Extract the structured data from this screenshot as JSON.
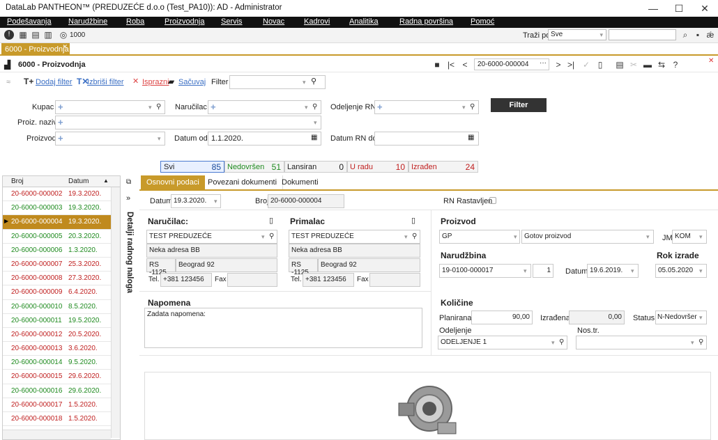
{
  "window": {
    "title": "DataLab PANTHEON™  (PREDUZEĆE d.o.o (Test_PA10)): AD - Administrator",
    "min": "—",
    "max": "☐",
    "close": "✕"
  },
  "menu": [
    "Podešavanja",
    "Narudžbine",
    "Roba",
    "Proizvodnja",
    "Servis",
    "Novac",
    "Kadrovi",
    "Analitika",
    "Radna površina",
    "Pomoć"
  ],
  "toolbar": {
    "counter": "1000",
    "search_label": "Traži po",
    "search_option": "Sve"
  },
  "doc_tab": "6000 - Proizvodnja",
  "module": {
    "title": "6000 - Proizvodnja",
    "doc_number": "20-6000-000004"
  },
  "filterbar": {
    "add": "Dodaj filter",
    "remove": "Izbriši filter",
    "clear": "Isprazni",
    "save": "Sačuvaj",
    "filter": "Filter"
  },
  "filters": {
    "kupac": "Kupac",
    "narucilac": "Naručilac",
    "odeljenje": "Odeljenje RN",
    "proiz_naziv": "Proiz. naziv",
    "proizvod": "Proizvod",
    "datum_od": "Datum od",
    "datum_od_val": "1.1.2020.",
    "datum_do": "Datum RN do",
    "button": "Filter"
  },
  "status": [
    {
      "label": "Svi",
      "count": "85",
      "color": "#1a4a9a"
    },
    {
      "label": "Nedovršen",
      "count": "51",
      "color": "#1e8a1e"
    },
    {
      "label": "Lansiran",
      "count": "0",
      "color": "#222222"
    },
    {
      "label": "U radu",
      "count": "10",
      "color": "#c02020"
    },
    {
      "label": "Izrađen",
      "count": "24",
      "color": "#c02020"
    }
  ],
  "grid": {
    "col_broj": "Broj",
    "col_datum": "Datum",
    "rows": [
      [
        "20-6000-000002",
        "19.3.2020.",
        "r"
      ],
      [
        "20-6000-000003",
        "19.3.2020.",
        "g"
      ],
      [
        "20-6000-000004",
        "19.3.2020.",
        "s"
      ],
      [
        "20-6000-000005",
        "20.3.2020.",
        "g"
      ],
      [
        "20-6000-000006",
        "1.3.2020.",
        "g"
      ],
      [
        "20-6000-000007",
        "25.3.2020.",
        "r"
      ],
      [
        "20-6000-000008",
        "27.3.2020.",
        "r"
      ],
      [
        "20-6000-000009",
        "6.4.2020.",
        "r"
      ],
      [
        "20-6000-000010",
        "8.5.2020.",
        "g"
      ],
      [
        "20-6000-000011",
        "19.5.2020.",
        "g"
      ],
      [
        "20-6000-000012",
        "20.5.2020.",
        "r"
      ],
      [
        "20-6000-000013",
        "3.6.2020.",
        "r"
      ],
      [
        "20-6000-000014",
        "9.5.2020.",
        "g"
      ],
      [
        "20-6000-000015",
        "29.6.2020.",
        "r"
      ],
      [
        "20-6000-000016",
        "29.6.2020.",
        "g"
      ],
      [
        "20-6000-000017",
        "1.5.2020.",
        "r"
      ],
      [
        "20-6000-000018",
        "1.5.2020.",
        "r"
      ]
    ]
  },
  "side_label": "Detalji radnog naloga",
  "tabs": [
    "Osnovni podaci",
    "Povezani dokumenti",
    "Dokumenti"
  ],
  "detail": {
    "datum_lbl": "Datum",
    "datum": "19.3.2020.",
    "broj_lbl": "Broj",
    "broj": "20-6000-000004",
    "rn_rast": "RN Rastavljen",
    "narucilac": {
      "title": "Naručilac:",
      "name": "TEST PREDUZEĆE",
      "addr": "Neka adresa BB",
      "zip": "RS -1125",
      "city": "Beograd 92",
      "tel_lbl": "Tel.",
      "tel": "+381 123456",
      "fax_lbl": "Fax"
    },
    "primalac": {
      "title": "Primalac",
      "name": "TEST PREDUZEĆE",
      "addr": "Neka adresa BB",
      "zip": "RS -1125",
      "city": "Beograd 92",
      "tel_lbl": "Tel.",
      "tel": "+381 123456",
      "fax_lbl": "Fax"
    },
    "proizvod": {
      "title": "Proizvod",
      "code": "GP",
      "name": "Gotov proizvod",
      "jm_lbl": "JM",
      "jm": "KOM"
    },
    "narudzbina": {
      "title": "Narudžbina",
      "num": "19-0100-000017",
      "pos": "1",
      "datum_lbl": "Datum",
      "datum": "19.6.2019."
    },
    "rok": {
      "title": "Rok izrade",
      "val": "05.05.2020"
    },
    "napomena": {
      "title": "Napomena",
      "text": "Zadata napomena:"
    },
    "kolicine": {
      "title": "Količine",
      "plan_lbl": "Planirana",
      "plan": "90,00",
      "izr_lbl": "Izrađena",
      "izr": "0,00",
      "status_lbl": "Status",
      "status": "N-Nedovršer",
      "odel_lbl": "Odeljenje",
      "odel": "ODELJENJE 1",
      "nostr_lbl": "Nos.tr."
    },
    "slika": "Slika proizvoda"
  }
}
